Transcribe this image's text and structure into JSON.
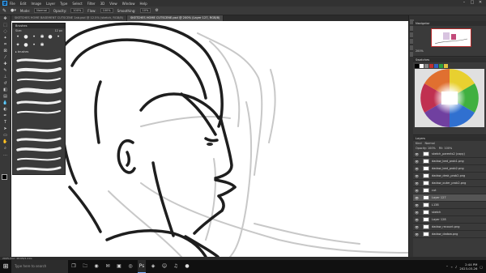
{
  "menu": {
    "app_icon": "Ps",
    "items": [
      "File",
      "Edit",
      "Image",
      "Layer",
      "Type",
      "Select",
      "Filter",
      "3D",
      "View",
      "Window",
      "Help"
    ]
  },
  "options": {
    "mode_label": "Mode:",
    "mode_value": "Normal",
    "opacity_label": "Opacity:",
    "opacity_value": "100%",
    "flow_label": "Flow:",
    "flow_value": "100%",
    "smoothing_label": "Smoothing:",
    "smoothing_value": "10%"
  },
  "tabs": [
    {
      "label": "SKETCHES HOME BASEMENT CUTSCENE 1ab.psd @ 12.5% (sketch, RGB/8)"
    },
    {
      "label": "SKETCHES HOME CUTSCENE.psd @ 200% (Layer 127, RGB/8)"
    }
  ],
  "brushes": {
    "title": "Brushes",
    "size_label": "Size:",
    "size_value": "12 px",
    "group_label": "▸ brushes"
  },
  "navigator": {
    "title": "Navigator",
    "zoom": "200%"
  },
  "swatches": {
    "title": "Swatches"
  },
  "layers": {
    "title": "Layers",
    "kind_label": "Kind",
    "blend_mode": "Normal",
    "opacity_label": "Opacity: 100%",
    "fill_label": "Fill: 100%",
    "items": [
      {
        "name": "sketch_parents2 (copy)",
        "eye": "👁"
      },
      {
        "name": "dadaw_bed_prob1.png",
        "eye": "👁"
      },
      {
        "name": "dadaw_bed_prob2.png",
        "eye": "👁"
      },
      {
        "name": "dadaw_desk_prob2.png",
        "eye": "👁"
      },
      {
        "name": "dadaw_outer_prob2.png",
        "eye": "👁"
      },
      {
        "name": "cut",
        "eye": "👁"
      },
      {
        "name": "Layer 127",
        "eye": "👁"
      },
      {
        "name": "L138",
        "eye": "👁"
      },
      {
        "name": "sketch",
        "eye": "👁"
      },
      {
        "name": "Layer 128",
        "eye": "👁"
      },
      {
        "name": "dadaw_recount.png",
        "eye": "👁"
      },
      {
        "name": "dadaw_dadaw.png",
        "eye": "👁"
      }
    ]
  },
  "status": {
    "text": "200%      Doc: 48.6M/1.41G"
  },
  "taskbar": {
    "search_placeholder": "Type here to search",
    "time": "2:44 PM",
    "date": "2023-03-26"
  },
  "colors": {
    "accent": "#31a8ff",
    "highlight_red": "#b52a2a"
  }
}
